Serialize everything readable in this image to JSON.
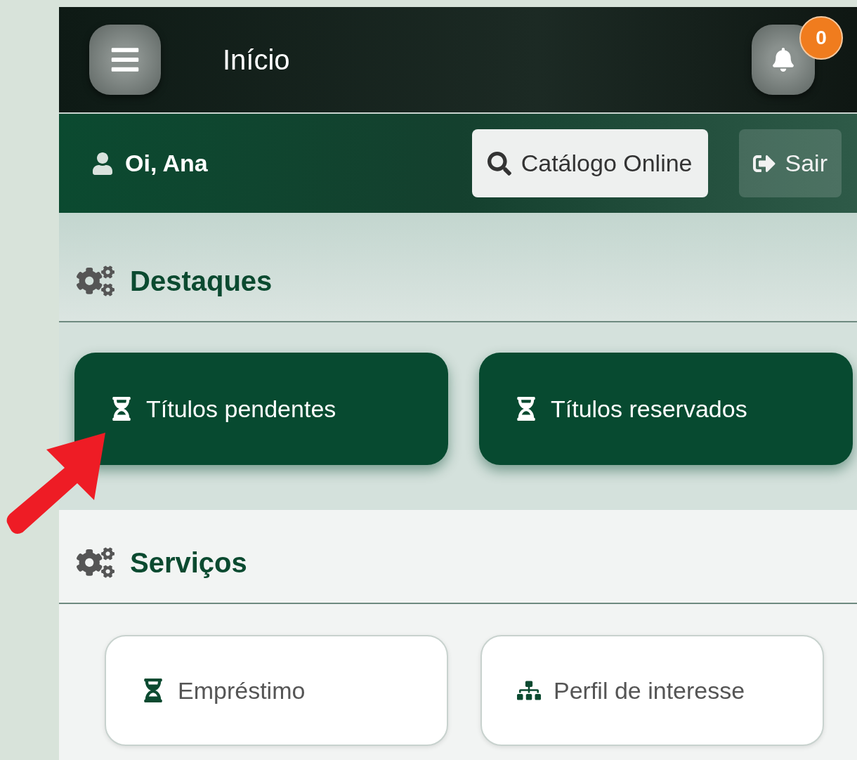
{
  "header": {
    "title": "Início",
    "notification_count": "0"
  },
  "user_bar": {
    "greeting": "Oi, Ana",
    "catalog_button": "Catálogo Online",
    "logout_button": "Sair"
  },
  "sections": [
    {
      "title": "Destaques",
      "kind": "highlight",
      "items": [
        {
          "label": "Títulos pendentes"
        },
        {
          "label": "Títulos reservados"
        }
      ]
    },
    {
      "title": "Serviços",
      "kind": "service",
      "items": [
        {
          "label": "Empréstimo"
        },
        {
          "label": "Perfil de interesse"
        }
      ]
    }
  ]
}
